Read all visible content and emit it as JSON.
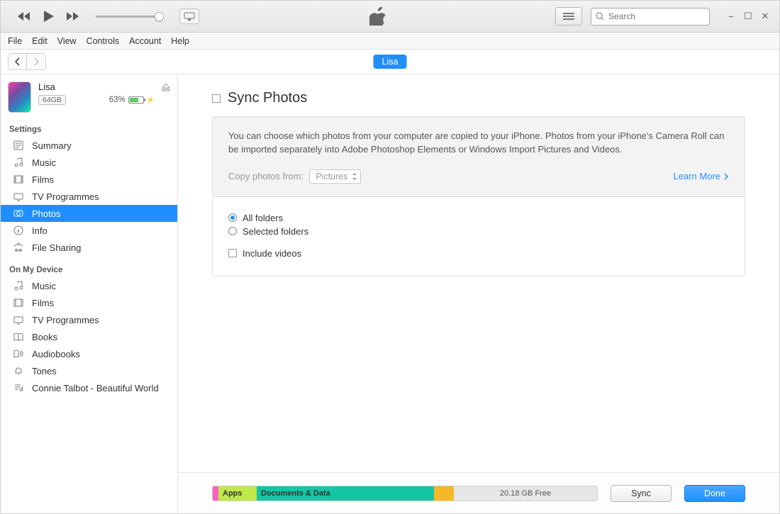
{
  "window_controls": {
    "minimize": "−",
    "maximize": "☐",
    "close": "✕"
  },
  "search": {
    "placeholder": "Search"
  },
  "menubar": [
    "File",
    "Edit",
    "View",
    "Controls",
    "Account",
    "Help"
  ],
  "nav": {
    "device_pill": "Lisa"
  },
  "device": {
    "name": "Lisa",
    "capacity": "64GB",
    "battery_pct": "63%",
    "charging": true
  },
  "sidebar": {
    "settings_header": "Settings",
    "onmydevice_header": "On My Device",
    "settings": [
      {
        "label": "Summary",
        "icon": "summary-icon"
      },
      {
        "label": "Music",
        "icon": "music-icon"
      },
      {
        "label": "Films",
        "icon": "film-icon"
      },
      {
        "label": "TV Programmes",
        "icon": "tv-icon"
      },
      {
        "label": "Photos",
        "icon": "photo-icon",
        "active": true
      },
      {
        "label": "Info",
        "icon": "info-icon"
      },
      {
        "label": "File Sharing",
        "icon": "apps-icon"
      }
    ],
    "onmydevice": [
      {
        "label": "Music",
        "icon": "music-icon"
      },
      {
        "label": "Films",
        "icon": "film-icon"
      },
      {
        "label": "TV Programmes",
        "icon": "tv-icon"
      },
      {
        "label": "Books",
        "icon": "book-icon"
      },
      {
        "label": "Audiobooks",
        "icon": "audiobook-icon"
      },
      {
        "label": "Tones",
        "icon": "bell-icon"
      },
      {
        "label": "Connie Talbot - Beautiful World",
        "icon": "playlist-icon"
      }
    ]
  },
  "content": {
    "title": "Sync Photos",
    "description": "You can choose which photos from your computer are copied to your iPhone. Photos from your iPhone's Camera Roll can be imported separately into Adobe Photoshop Elements or Windows Import Pictures and Videos.",
    "copy_label": "Copy photos from:",
    "copy_source": "Pictures",
    "learn_more": "Learn More",
    "opt_all": "All folders",
    "opt_selected": "Selected folders",
    "opt_include_videos": "Include videos"
  },
  "storage": {
    "apps_label": "Apps",
    "docs_label": "Documents & Data",
    "free_label": "20.18 GB Free"
  },
  "buttons": {
    "sync": "Sync",
    "done": "Done"
  },
  "icons": {
    "rewind": "rewind-icon",
    "play": "play-icon",
    "forward": "forward-icon",
    "airplay": "airplay-icon",
    "list": "list-icon",
    "search": "search-icon",
    "apple": "apple-logo-icon",
    "eject": "eject-icon",
    "back": "back-icon",
    "next": "forward-nav-icon",
    "bolt": "bolt-icon",
    "chevron": "chevron-right-icon"
  }
}
